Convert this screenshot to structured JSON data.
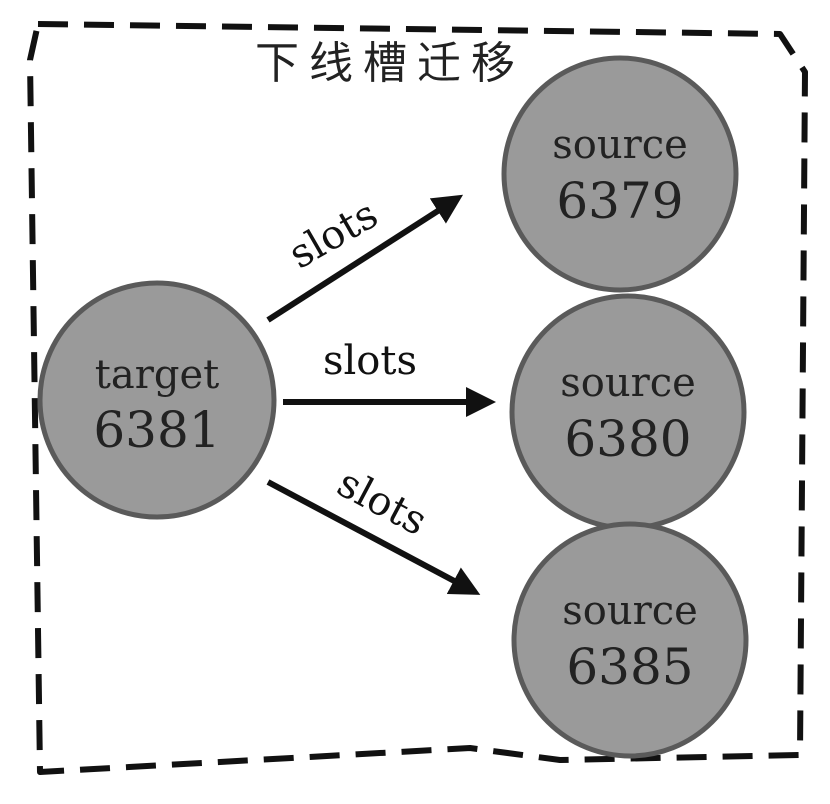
{
  "title": "下线槽迁移",
  "colors": {
    "node_fill": "#9a9a9a",
    "node_stroke": "#5a5a5a",
    "line": "#111111",
    "border": "#111111"
  },
  "nodes": {
    "target": {
      "label": "target",
      "port": "6381"
    },
    "source_top": {
      "label": "source",
      "port": "6379"
    },
    "source_middle": {
      "label": "source",
      "port": "6380"
    },
    "source_bottom": {
      "label": "source",
      "port": "6385"
    }
  },
  "edges": [
    {
      "label": "slots",
      "from": "target",
      "to": "source_top"
    },
    {
      "label": "slots",
      "from": "target",
      "to": "source_middle"
    },
    {
      "label": "slots",
      "from": "target",
      "to": "source_bottom"
    }
  ]
}
